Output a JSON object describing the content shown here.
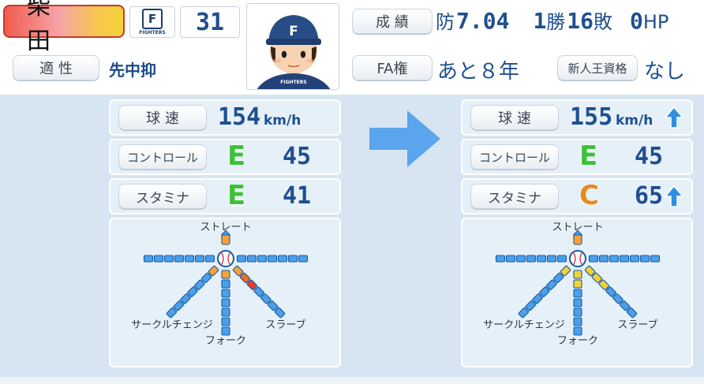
{
  "player": {
    "name": "柴 田",
    "team_logo_text": "F",
    "team_logo_sub": "FIGHTERS",
    "number": "31",
    "aptitude_label": "適 性",
    "aptitude_value": "先中抑",
    "avatar_cap_letter": "F",
    "avatar_shirt_text": "FIGHTERS"
  },
  "record": {
    "label": "成 績",
    "era_label": "防",
    "era": "7.04",
    "wins": "1",
    "wins_label": "勝",
    "losses": "16",
    "losses_label": "敗",
    "hp": "0",
    "hp_label": "HP"
  },
  "fa": {
    "label": "FA権",
    "value": "あと８年",
    "rookie_label": "新人王資格",
    "rookie_value": "なし"
  },
  "before": {
    "speed_label": "球 速",
    "speed_value": "154",
    "speed_unit": "km/h",
    "control_label": "コントロール",
    "control_grade": "E",
    "control_value": "45",
    "stamina_label": "スタミナ",
    "stamina_grade": "E",
    "stamina_value": "41",
    "pitches": {
      "straight": "ストレート",
      "circle_change": "サークルチェンジ",
      "fork": "フォーク",
      "slurve": "スラーブ"
    }
  },
  "after": {
    "speed_label": "球 速",
    "speed_value": "155",
    "speed_unit": "km/h",
    "control_label": "コントロール",
    "control_grade": "E",
    "control_value": "45",
    "stamina_label": "スタミナ",
    "stamina_grade": "C",
    "stamina_value": "65",
    "pitches": {
      "straight": "ストレート",
      "circle_change": "サークルチェンジ",
      "fork": "フォーク",
      "slurve": "スラーブ"
    }
  },
  "pitch_levels": {
    "before": {
      "straight": 1,
      "left": 0,
      "right": 0,
      "slurve": 3,
      "fork": 1,
      "circle_change": 1
    },
    "after": {
      "straight": 1,
      "left": 0,
      "right": 0,
      "slurve": 3,
      "fork": 2,
      "circle_change": 1
    }
  },
  "colors": {
    "grade_E": "#3fbf3a",
    "grade_C": "#e58a1f",
    "panel_bg": "#d7e5f2",
    "value_blue": "#1f4f8f",
    "arrow": "#5aa5ee",
    "up_arrow": "#2f8fe0"
  },
  "icons": {
    "transition": "right-arrow-icon",
    "increase": "up-arrow-icon",
    "pitch_center": "baseball-icon"
  }
}
